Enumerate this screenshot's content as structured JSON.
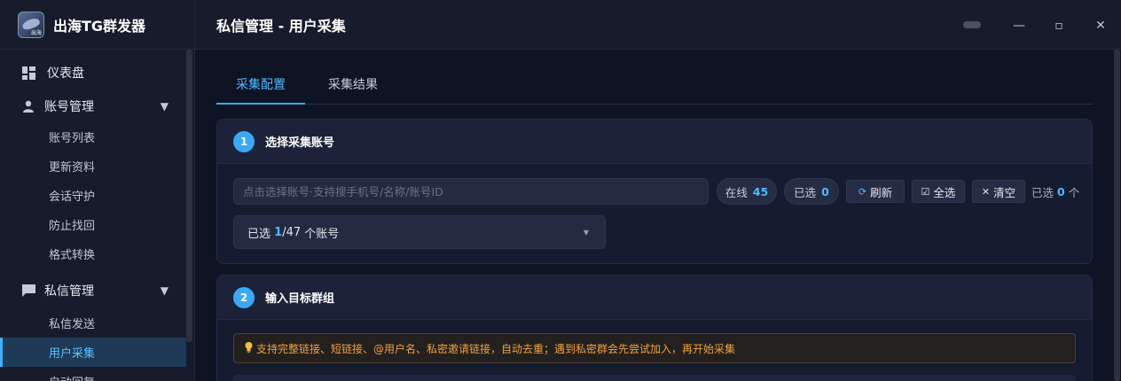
{
  "app": {
    "title": "出海TG群发器",
    "logo_tag": "出海"
  },
  "header": {
    "page_title": "私信管理 - 用户采集",
    "window_controls": {
      "minimize": "—",
      "maximize": "▫",
      "close": "✕"
    }
  },
  "sidebar": {
    "dashboard": {
      "label": "仪表盘",
      "icon": "dashboard-icon"
    },
    "groups": [
      {
        "label": "账号管理",
        "icon": "user-icon",
        "expanded": true,
        "items": [
          "账号列表",
          "更新资料",
          "会话守护",
          "防止找回",
          "格式转换"
        ]
      },
      {
        "label": "私信管理",
        "icon": "chat-icon",
        "expanded": true,
        "items": [
          "私信发送",
          "用户采集",
          "自动回复"
        ]
      }
    ],
    "active_item": "用户采集"
  },
  "tabs": [
    {
      "label": "采集配置",
      "active": true
    },
    {
      "label": "采集结果",
      "active": false
    }
  ],
  "step1": {
    "number": "1",
    "title": "选择采集账号",
    "search_placeholder": "点击选择账号·支持搜手机号/名称/账号ID",
    "online_label": "在线",
    "online_count": "45",
    "selected_label": "已选",
    "selected_count": "0",
    "refresh_label": "刷新",
    "select_all_label": "全选",
    "clear_label": "清空",
    "selected_summary_prefix": "已选",
    "selected_summary_count": "0",
    "selected_summary_suffix": "个",
    "dropdown_prefix": "已选",
    "dropdown_selected": "1",
    "dropdown_total": "/47",
    "dropdown_suffix": "个账号"
  },
  "step2": {
    "number": "2",
    "title": "输入目标群组",
    "tip": "支持完整链接、短链接、@用户名、私密邀请链接，自动去重；遇到私密群会先尝试加入，再开始采集"
  },
  "colors": {
    "accent": "#3aa8f5",
    "background": "#0f1424",
    "sidebar": "#171c2c",
    "card": "#161c30",
    "tip_text": "#f0a23c"
  }
}
